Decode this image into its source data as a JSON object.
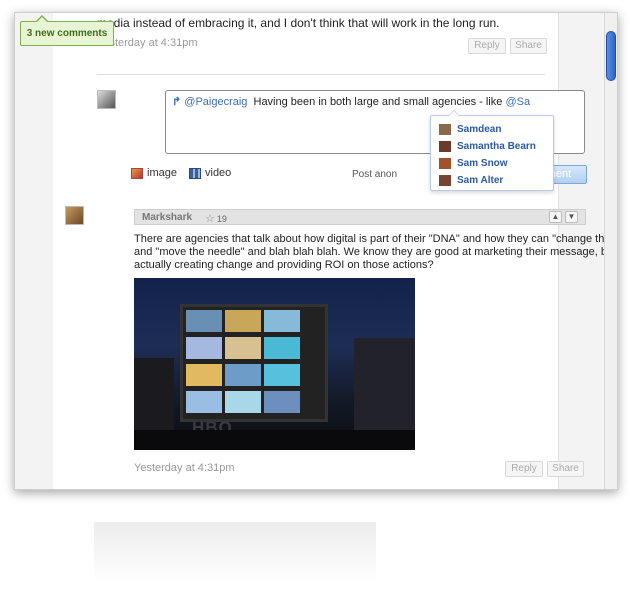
{
  "notification": {
    "label": "3 new comments"
  },
  "top_comment": {
    "text": "media instead of embracing it, and I don't think that will work in the long run.",
    "timestamp": "Yesterday at 4:31pm",
    "reply_label": "Reply",
    "share_label": "Share"
  },
  "composer": {
    "reply_to": "@Paigecraig",
    "text": "Having been in both large and small agencies - like",
    "typing": "@Sa",
    "image_label": "image",
    "video_label": "video",
    "post_anon_label": "Post anon",
    "post_button_label": "Post comment"
  },
  "mention_suggestions": [
    {
      "name": "Samdean"
    },
    {
      "name": "Samantha Bearn"
    },
    {
      "name": "Sam Snow"
    },
    {
      "name": "Sam Alter"
    }
  ],
  "comment2": {
    "author": "Markshark",
    "score": "19",
    "line1": "There are agencies that talk about how digital is part of their \"DNA\" and how they can \"change the culture\"",
    "line2": "and \"move the needle\" and blah blah blah. We know they are good at marketing their message, but are the",
    "line3": "actually creating change and providing ROI on those actions?",
    "photo_text": "HBO",
    "timestamp": "Yesterday at 4:31pm",
    "reply_label": "Reply",
    "share_label": "Share"
  },
  "colors": {
    "accent": "#3b6fb6",
    "notif_bg": "#e8f5d4",
    "notif_border": "#7fb04a"
  }
}
